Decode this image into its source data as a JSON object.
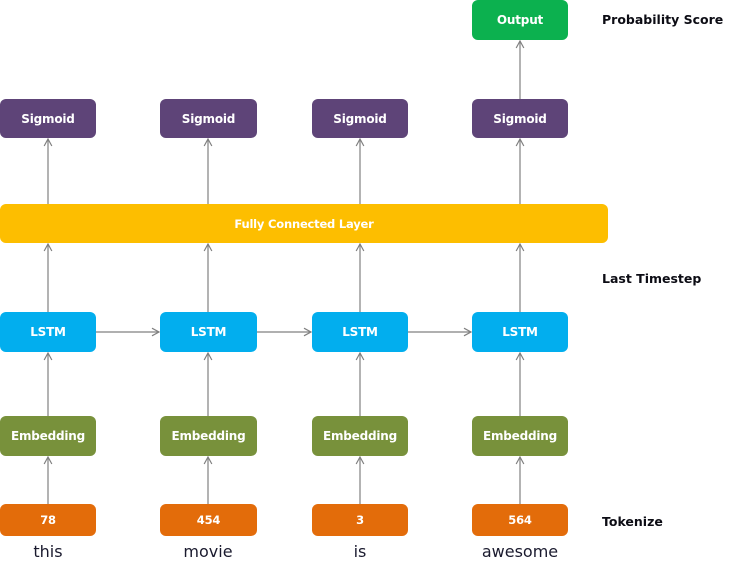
{
  "diagram": {
    "columns": [
      {
        "word": "this",
        "token": "78",
        "embedding": "Embedding",
        "lstm": "LSTM",
        "sigmoid": "Sigmoid"
      },
      {
        "word": "movie",
        "token": "454",
        "embedding": "Embedding",
        "lstm": "LSTM",
        "sigmoid": "Sigmoid"
      },
      {
        "word": "is",
        "token": "3",
        "embedding": "Embedding",
        "lstm": "LSTM",
        "sigmoid": "Sigmoid"
      },
      {
        "word": "awesome",
        "token": "564",
        "embedding": "Embedding",
        "lstm": "LSTM",
        "sigmoid": "Sigmoid"
      }
    ],
    "fully_connected": "Fully Connected Layer",
    "output": "Output",
    "side_labels": {
      "probability": "Probability Score",
      "last_timestep": "Last Timestep",
      "tokenize": "Tokenize"
    },
    "colors": {
      "sigmoid": "#5e4478",
      "output": "#0cb14f",
      "fully_connected": "#fdbe00",
      "lstm": "#02aeee",
      "embedding": "#78913b",
      "token": "#e36c0a",
      "arrow": "#808080"
    }
  }
}
